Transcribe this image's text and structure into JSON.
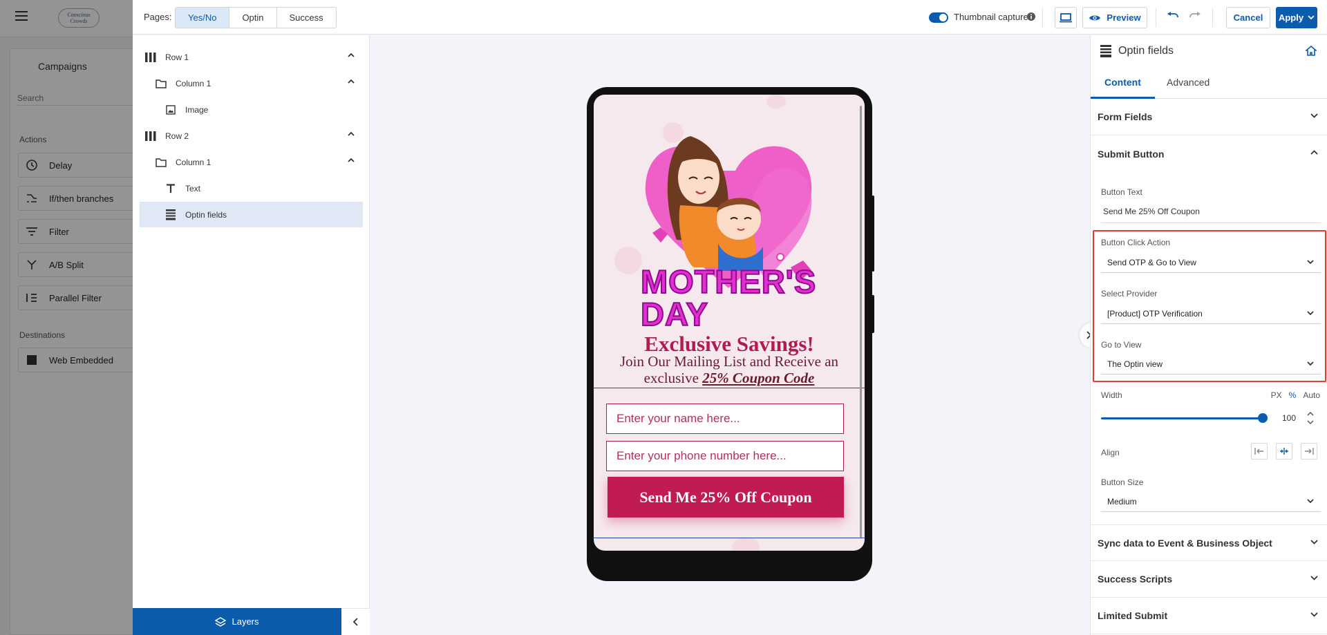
{
  "background_app": {
    "logo": "Conscious Crowds",
    "campaigns_title": "Campaigns",
    "search_placeholder": "Search",
    "actions_title": "Actions",
    "actions": [
      "Delay",
      "If/then branches",
      "Filter",
      "A/B Split",
      "Parallel Filter"
    ],
    "destinations_title": "Destinations",
    "destinations": [
      "Web Embedded"
    ]
  },
  "topbar": {
    "pages_label": "Pages:",
    "page_tabs": [
      "Yes/No",
      "Optin",
      "Success"
    ],
    "active_tab": "Yes/No",
    "thumbnail_label": "Thumbnail capture",
    "thumbnail_on": true,
    "preview_label": "Preview",
    "cancel_label": "Cancel",
    "apply_label": "Apply"
  },
  "layers": {
    "items": [
      {
        "label": "Row 1",
        "icon": "columns-icon",
        "expanded": true
      },
      {
        "label": "Column 1",
        "icon": "folder-icon",
        "expanded": true
      },
      {
        "label": "Image",
        "icon": "image-icon"
      },
      {
        "label": "Row 2",
        "icon": "columns-icon",
        "expanded": true
      },
      {
        "label": "Column 1",
        "icon": "folder-icon",
        "expanded": true
      },
      {
        "label": "Text",
        "icon": "text-icon"
      },
      {
        "label": "Optin fields",
        "icon": "form-icon",
        "selected": true
      }
    ],
    "footer_label": "Layers"
  },
  "preview": {
    "title_line1": "MOTHER'S",
    "title_line2": "DAY",
    "headline": "Exclusive Savings!",
    "subtext_prefix": "Join Our Mailing List and Receive an exclusive ",
    "subtext_emphasis": "25% Coupon Code",
    "name_placeholder": "Enter your name here...",
    "phone_placeholder": "Enter your phone number here...",
    "submit_label": "Send Me 25% Off Coupon"
  },
  "properties": {
    "header": "Optin fields",
    "tabs": [
      "Content",
      "Advanced"
    ],
    "active_tab": "Content",
    "sections": {
      "form_fields": "Form Fields",
      "submit_button": "Submit Button",
      "sync": "Sync data to Event & Business Object",
      "success_scripts": "Success Scripts",
      "limited_submit": "Limited Submit"
    },
    "button_text_label": "Button Text",
    "button_text_value": "Send Me 25% Off Coupon",
    "click_action_label": "Button Click Action",
    "click_action_value": "Send OTP & Go to View",
    "provider_label": "Select Provider",
    "provider_value": "[Product] OTP Verification",
    "go_to_view_label": "Go to View",
    "go_to_view_value": "The Optin view",
    "width_label": "Width",
    "width_units": [
      "PX",
      "%",
      "Auto"
    ],
    "width_active_unit": "%",
    "width_value": "100",
    "align_label": "Align",
    "button_size_label": "Button Size",
    "button_size_value": "Medium"
  },
  "colors": {
    "accent": "#0b5cad",
    "brand_pink": "#c01c52",
    "highlight": "#e23a3a"
  }
}
